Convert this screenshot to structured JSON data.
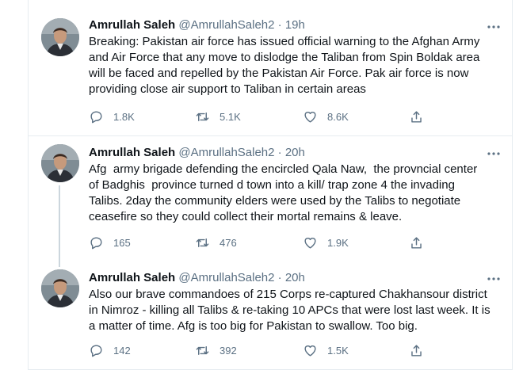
{
  "thread": [
    {
      "author": "Amrullah Saleh",
      "handle": "@AmrullahSaleh2",
      "separator": "·",
      "time": "19h",
      "lines": [
        "Breaking: Pakistan air force has issued official warning to the Afghan Army",
        "and Air Force that any move to dislodge the Taliban from Spin Boldak area",
        "will be faced and repelled by the Pakistan Air Force. Pak air force is now",
        "providing close air support to Taliban in certain areas"
      ],
      "replies": "1.8K",
      "retweets": "5.1K",
      "likes": "8.6K"
    },
    {
      "author": "Amrullah Saleh",
      "handle": "@AmrullahSaleh2",
      "separator": "·",
      "time": "20h",
      "lines": [
        "Afg  army brigade defending the encircled Qala Naw,  the provncial center",
        "of Badghis  province turned d town into a kill/ trap zone 4 the invading",
        "Talibs. 2day the community elders were used by the Talibs to negotiate",
        "ceasefire so they could collect their mortal remains & leave."
      ],
      "replies": "165",
      "retweets": "476",
      "likes": "1.9K"
    },
    {
      "author": "Amrullah Saleh",
      "handle": "@AmrullahSaleh2",
      "separator": "·",
      "time": "20h",
      "lines": [
        "Also our brave commandoes of 215 Corps re-captured Chakhansour district",
        "in Nimroz - killing all Talibs & re-taking 10 APCs that were lost last week. It is",
        "a matter of time. Afg is too big for Pakistan to swallow. Too big."
      ],
      "replies": "142",
      "retweets": "392",
      "likes": "1.5K"
    }
  ],
  "icons": {
    "reply": "reply-icon",
    "retweet": "retweet-icon",
    "like": "heart-icon",
    "share": "share-icon",
    "more": "more-options-icon"
  },
  "colors": {
    "text": "#0f1419",
    "secondary": "#5b7083",
    "divider": "#e6ecf0",
    "thread_line": "#ccd6dd"
  }
}
